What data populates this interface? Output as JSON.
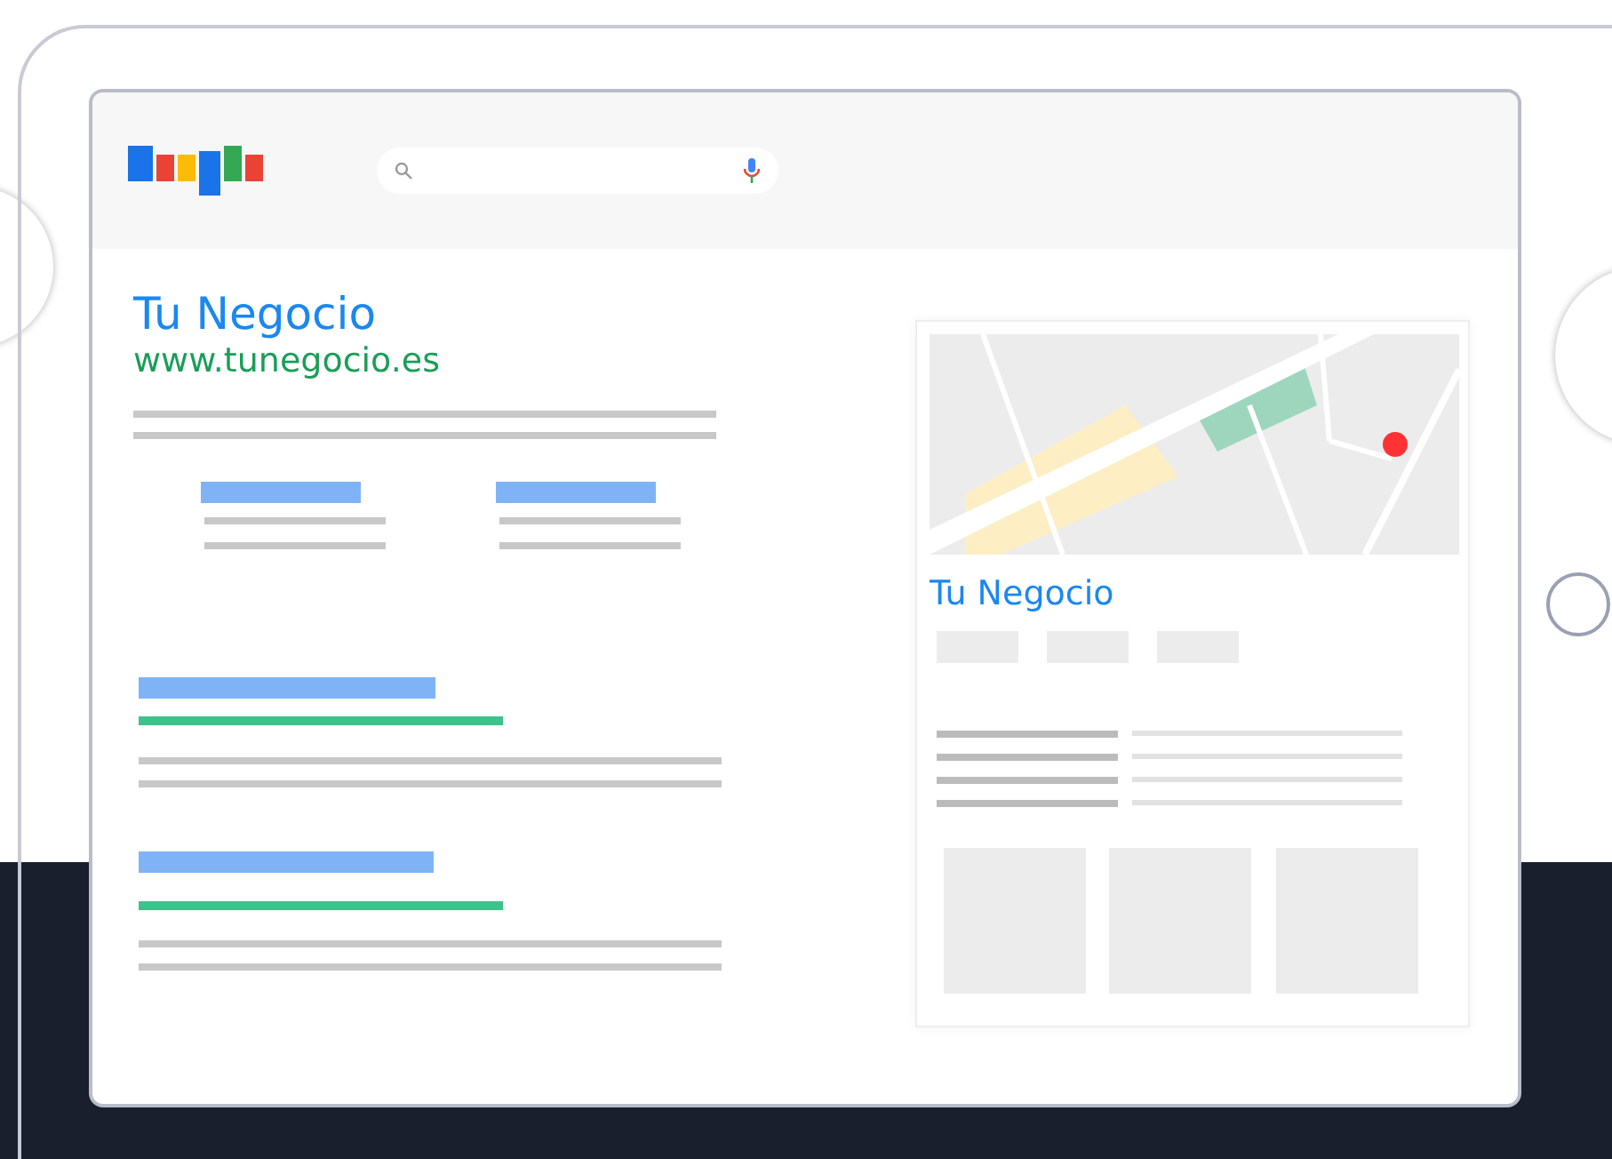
{
  "result": {
    "title": "Tu Negocio",
    "url": "www.tunegocio.es"
  },
  "business_panel": {
    "title": "Tu Negocio"
  }
}
